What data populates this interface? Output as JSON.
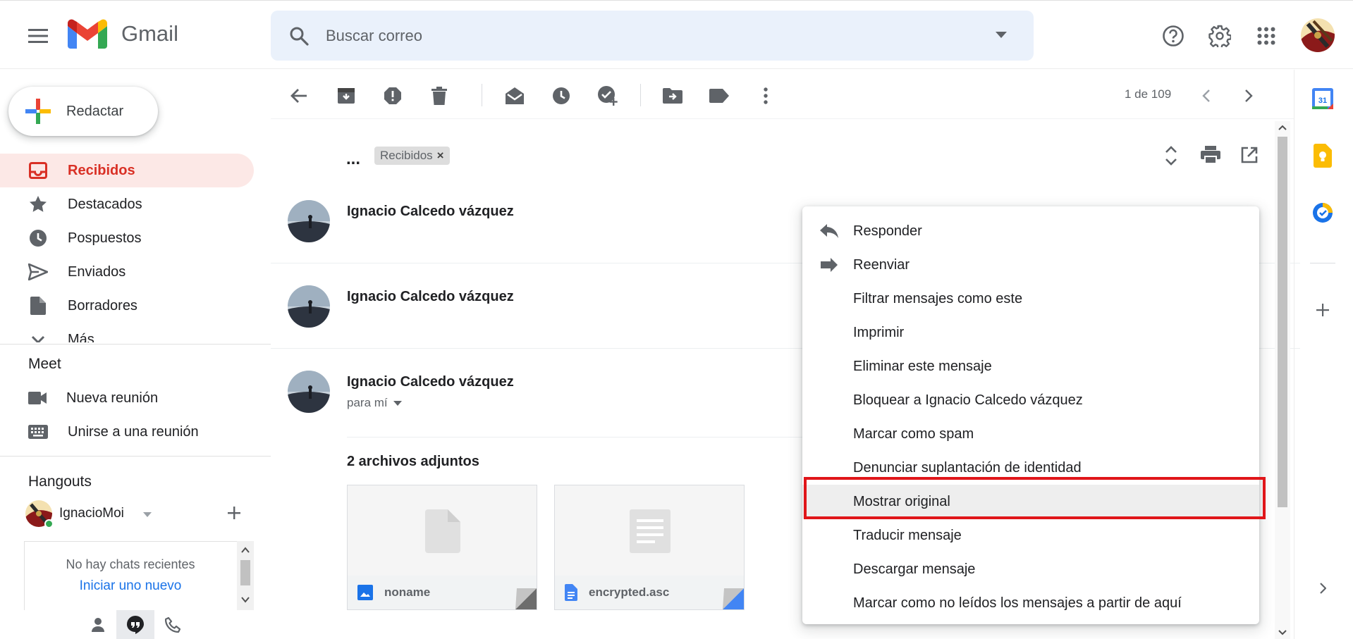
{
  "app": {
    "name": "Gmail"
  },
  "search": {
    "placeholder": "Buscar correo"
  },
  "sidebar": {
    "compose_label": "Redactar",
    "items": [
      {
        "label": "Recibidos",
        "icon": "inbox-icon",
        "active": true
      },
      {
        "label": "Destacados",
        "icon": "star-icon"
      },
      {
        "label": "Pospuestos",
        "icon": "clock-icon"
      },
      {
        "label": "Enviados",
        "icon": "send-icon"
      },
      {
        "label": "Borradores",
        "icon": "draft-icon"
      },
      {
        "label": "Más",
        "icon": "chevron-down-icon"
      }
    ],
    "meet": {
      "title": "Meet",
      "items": [
        {
          "label": "Nueva reunión",
          "icon": "video-icon"
        },
        {
          "label": "Unirse a una reunión",
          "icon": "keyboard-icon"
        }
      ]
    },
    "hangouts": {
      "title": "Hangouts",
      "user": "IgnacioMoi",
      "no_chats": "No hay chats recientes",
      "start_new": "Iniciar uno nuevo"
    }
  },
  "toolbar": {
    "pager": "1 de 109"
  },
  "conversation": {
    "subject_truncated": "...",
    "label": "Recibidos",
    "messages": [
      {
        "sender": "Ignacio Calcedo vázquez"
      },
      {
        "sender": "Ignacio Calcedo vázquez"
      },
      {
        "sender": "Ignacio Calcedo vázquez",
        "to": "para mí"
      }
    ],
    "attachments_title": "2 archivos adjuntos",
    "attachments": [
      {
        "name": "noname",
        "icon": "image-file-icon"
      },
      {
        "name": "encrypted.asc",
        "icon": "doc-file-icon"
      }
    ]
  },
  "context_menu": {
    "items": [
      {
        "label": "Responder",
        "icon": "reply-icon"
      },
      {
        "label": "Reenviar",
        "icon": "forward-icon"
      },
      {
        "label": "Filtrar mensajes como este"
      },
      {
        "label": "Imprimir"
      },
      {
        "label": "Eliminar este mensaje"
      },
      {
        "label": "Bloquear a Ignacio Calcedo vázquez"
      },
      {
        "label": "Marcar como spam"
      },
      {
        "label": "Denunciar suplantación de identidad"
      },
      {
        "label": "Mostrar original",
        "highlighted": true
      },
      {
        "label": "Traducir mensaje"
      },
      {
        "label": "Descargar mensaje"
      },
      {
        "label": "Marcar como no leídos los mensajes a partir de aquí"
      }
    ]
  },
  "colors": {
    "accent_red": "#d93025",
    "highlight_border": "#e0161a",
    "link_blue": "#1a73e8"
  }
}
